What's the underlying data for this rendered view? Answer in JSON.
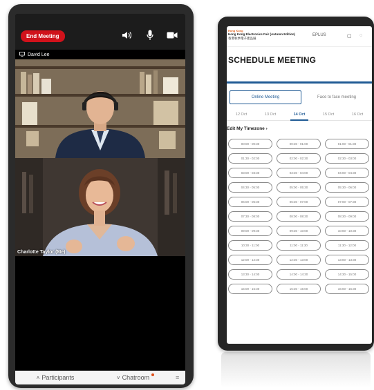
{
  "meeting": {
    "end_button": "End Meeting",
    "icons": [
      "speaker-icon",
      "microphone-icon",
      "camera-icon"
    ],
    "participant1_name": "David Lee",
    "participant2_name": "Charlotte Taylor (Me)",
    "bottom": {
      "participants": "Participants",
      "chatroom": "Chatroom"
    },
    "colors": {
      "end_button": "#d0121b",
      "notification_dot": "#e0501b"
    }
  },
  "schedule": {
    "fair_tag": "Hong Kong",
    "fair_name": "Hong Kong Electronics Fair (Autumn Edition)",
    "fair_name_cn": "香港秋季電子產品展",
    "eplus": "EPLUS",
    "title": "SCHEDULE MEETING",
    "tabs": {
      "online": "Online Meeting",
      "face": "Face to face meeting"
    },
    "dates": [
      "12 Oct",
      "13 Oct",
      "14 Oct",
      "15 Oct",
      "16 Oct"
    ],
    "selected_date": "14 Oct",
    "timezone": "Edit My Timezone",
    "slots": [
      "00:00 - 00:30",
      "00:30 - 01:00",
      "01:00 - 01:30",
      "01:30 - 02:00",
      "02:00 - 02:30",
      "02:30 - 03:00",
      "03:00 - 03:30",
      "03:30 - 04:00",
      "04:00 - 04:30",
      "04:30 - 05:00",
      "05:00 - 05:30",
      "05:30 - 06:00",
      "06:00 - 06:30",
      "06:30 - 07:00",
      "07:00 - 07:30",
      "07:30 - 08:00",
      "08:00 - 08:30",
      "08:30 - 09:00",
      "09:00 - 09:30",
      "09:30 - 10:00",
      "10:00 - 10:30",
      "10:30 - 11:00",
      "11:00 - 11:30",
      "11:30 - 12:00",
      "12:00 - 12:30",
      "12:30 - 13:00",
      "13:00 - 13:30",
      "13:30 - 14:00",
      "14:00 - 14:30",
      "14:30 - 15:00",
      "15:00 - 15:30",
      "15:30 - 16:00",
      "16:00 - 16:30"
    ],
    "colors": {
      "accent": "#1f5a94"
    }
  }
}
